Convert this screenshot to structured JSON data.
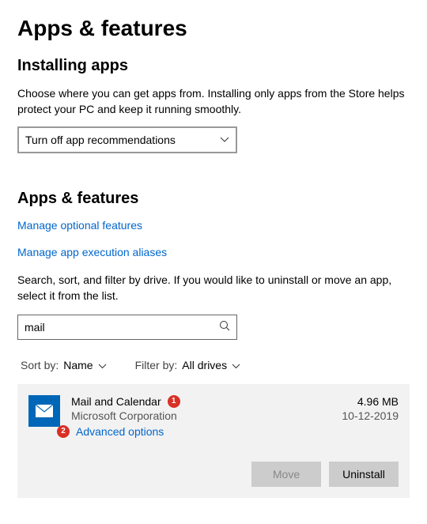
{
  "pageTitle": "Apps & features",
  "installing": {
    "heading": "Installing apps",
    "description": "Choose where you can get apps from. Installing only apps from the Store helps protect your PC and keep it running smoothly.",
    "dropdownValue": "Turn off app recommendations"
  },
  "appsFeatures": {
    "heading": "Apps & features",
    "linkOptional": "Manage optional features",
    "linkAliases": "Manage app execution aliases",
    "description": "Search, sort, and filter by drive. If you would like to uninstall or move an app, select it from the list.",
    "searchValue": "mail",
    "sortLabel": "Sort by:",
    "sortValue": "Name",
    "filterLabel": "Filter by:",
    "filterValue": "All drives"
  },
  "app": {
    "name": "Mail and Calendar",
    "publisher": "Microsoft Corporation",
    "advanced": "Advanced options",
    "size": "4.96 MB",
    "date": "10-12-2019",
    "badge1": "1",
    "badge2": "2",
    "moveBtn": "Move",
    "uninstallBtn": "Uninstall"
  }
}
